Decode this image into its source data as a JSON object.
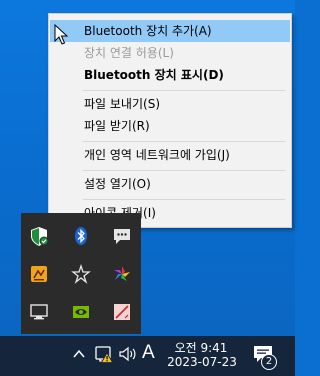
{
  "menu": {
    "items": [
      {
        "label": "Bluetooth 장치 추가(A)"
      },
      {
        "label": "장치 연결 허용(L)"
      },
      {
        "label": "Bluetooth 장치 표시(D)"
      },
      {
        "label": "파일 보내기(S)"
      },
      {
        "label": "파일 받기(R)"
      },
      {
        "label": "개인 영역 네트워크에 가입(J)"
      },
      {
        "label": "설정 열기(O)"
      },
      {
        "label": "아이콘 제거(I)"
      }
    ]
  },
  "tray": {
    "icons": [
      "windows-security-icon",
      "bluetooth-icon",
      "chat-bubble-icon",
      "app-orange-icon",
      "network-star-icon",
      "colorful-star-icon",
      "display-icon",
      "nvidia-icon",
      "pen-tool-icon"
    ]
  },
  "taskbar": {
    "ime_label": "A",
    "time": "오전 9:41",
    "date": "2023-07-23",
    "notification_count": "2"
  },
  "colors": {
    "menu_highlight": "#91c9f7",
    "taskbar_bg": "#15263c",
    "flyout_bg": "#2b2b2b",
    "desktop_bg": "#0a6fd1"
  }
}
